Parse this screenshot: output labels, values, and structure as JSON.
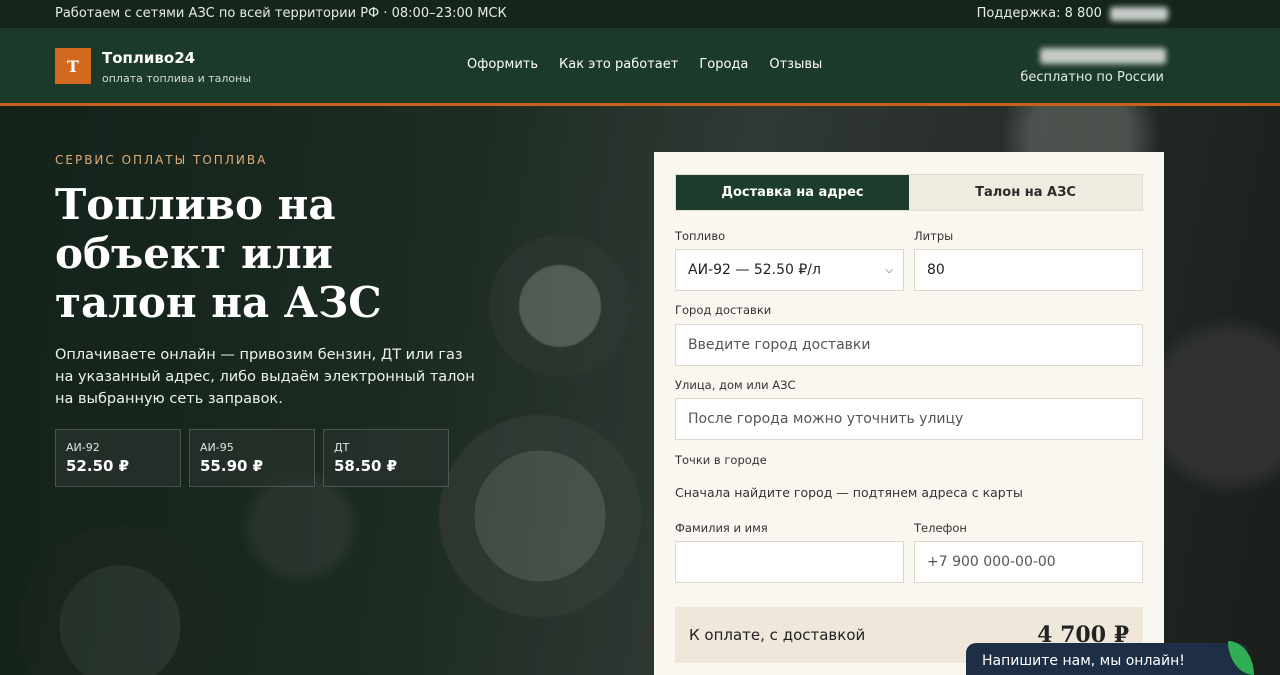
{
  "topbar": {
    "left": "Работаем с сетями АЗС по всей территории РФ · 08:00–23:00 МСК",
    "support": "Поддержка: 8 800"
  },
  "header": {
    "logo_letter": "Т",
    "brand": "Топливо24",
    "brand_sub": "оплата топлива и талоны",
    "nav": [
      "Оформить",
      "Как это работает",
      "Города",
      "Отзывы"
    ],
    "free_call": "бесплатно по России"
  },
  "hero": {
    "eyebrow": "СЕРВИС ОПЛАТЫ ТОПЛИВА",
    "title": "Топливо на объект или талон на АЗС",
    "description": "Оплачиваете онлайн — привозим бензин, ДТ или газ на указанный адрес, либо выдаём электронный талон на выбранную сеть заправок.",
    "prices": [
      {
        "label": "АИ-92",
        "value": "52.50 ₽"
      },
      {
        "label": "АИ-95",
        "value": "55.90 ₽"
      },
      {
        "label": "ДТ",
        "value": "58.50 ₽"
      }
    ]
  },
  "form": {
    "tabs": [
      "Доставка на адрес",
      "Талон на АЗС"
    ],
    "fuel_label": "Топливо",
    "fuel_value": "АИ-92 — 52.50 ₽/л",
    "liters_label": "Литры",
    "liters_value": "80",
    "city_label": "Город доставки",
    "city_placeholder": "Введите город доставки",
    "street_label": "Улица, дом или АЗС",
    "street_placeholder": "После города можно уточнить улицу",
    "points_label": "Точки в городе",
    "points_hint": "Сначала найдите город — подтянем адреса с карты",
    "name_label": "Фамилия и имя",
    "name_value": "",
    "phone_label": "Телефон",
    "phone_placeholder": "+7 900 000-00-00",
    "total_label": "К оплате, с доставкой",
    "total_value": "4 700 ₽"
  },
  "chat": {
    "label": "Напишите нам, мы онлайн!"
  },
  "colors": {
    "brand_green": "#1b3a2a",
    "accent_orange": "#d2691e",
    "eyebrow": "#e0ad77"
  }
}
